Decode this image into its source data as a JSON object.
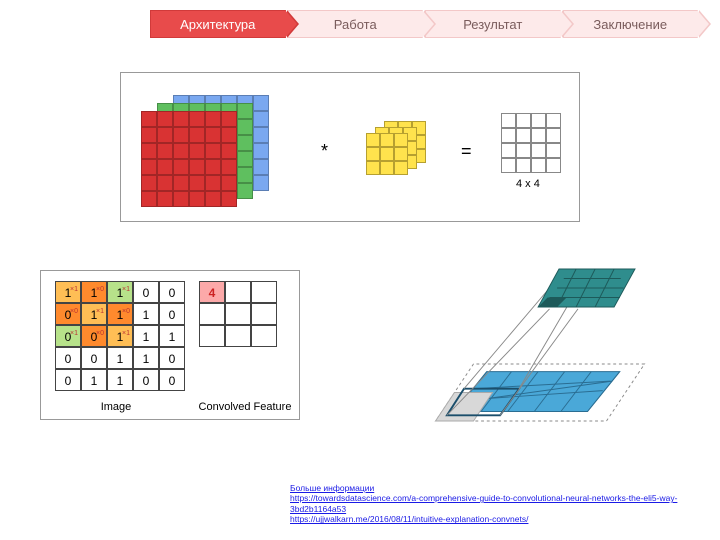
{
  "nav": {
    "items": [
      {
        "label": "Архитектура",
        "active": true
      },
      {
        "label": "Работа",
        "active": false
      },
      {
        "label": "Результат",
        "active": false
      },
      {
        "label": "Заключение",
        "active": false
      }
    ]
  },
  "fig1": {
    "op_conv": "*",
    "op_eq": "=",
    "out_label": "4 x 4"
  },
  "fig2": {
    "image_label": "Image",
    "feature_label": "Convolved\nFeature",
    "image_values": [
      [
        1,
        1,
        1,
        0,
        0
      ],
      [
        0,
        1,
        1,
        1,
        0
      ],
      [
        0,
        0,
        1,
        1,
        1
      ],
      [
        0,
        0,
        1,
        1,
        0
      ],
      [
        0,
        1,
        1,
        0,
        0
      ]
    ],
    "kernel_overlay": {
      "row": 0,
      "col": 0,
      "size": 3,
      "weights": [
        [
          1,
          0,
          1
        ],
        [
          0,
          1,
          0
        ],
        [
          1,
          0,
          1
        ]
      ]
    },
    "convolved": {
      "rows": 3,
      "cols": 3,
      "filled": [
        {
          "r": 0,
          "c": 0,
          "v": 4
        }
      ]
    }
  },
  "fig3": {
    "input_color": "#4aa8d8",
    "output_color": "#2f8d8d",
    "pad_color": "#d8d8d8"
  },
  "footer": {
    "title": "Больше информации",
    "links": [
      "https://towardsdatascience.com/a-comprehensive-guide-to-convolutional-neural-networks-the-eli5-way-3bd2b1164a53",
      "https://ujjwalkarn.me/2016/08/11/intuitive-explanation-convnets/"
    ]
  }
}
